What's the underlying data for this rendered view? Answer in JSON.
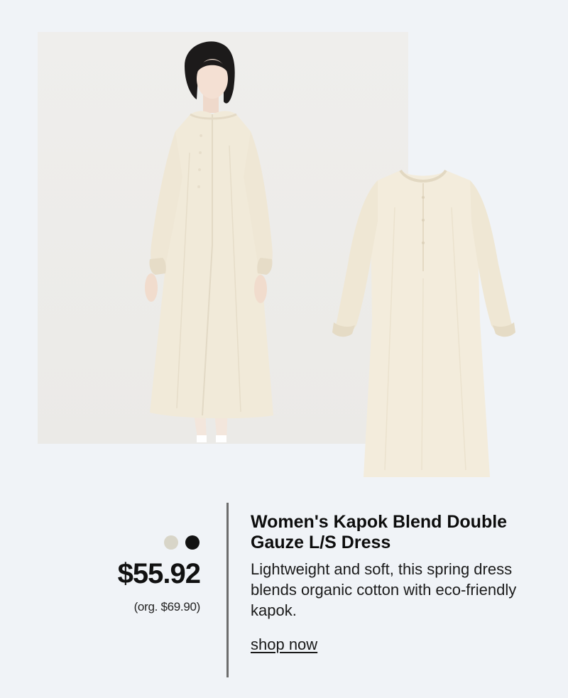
{
  "product": {
    "name": "Women's Kapok Blend Double Gauze L/S Dress",
    "description": "Lightweight and soft, this spring dress blends organic cotton with eco-friendly kapok.",
    "price": "$55.92",
    "original_price": "(org. $69.90)",
    "cta_label": "shop now",
    "colors": [
      {
        "name": "ecru",
        "hex": "#d8d5c8"
      },
      {
        "name": "black",
        "hex": "#121212"
      }
    ]
  },
  "images": {
    "model_photo": "model-wearing-dress-photo",
    "flat_photo": "dress-flat-lay-photo"
  },
  "theme": {
    "background": "#f0f3f7",
    "dress_color": "#f1ead9",
    "divider": "#6d6d6d"
  }
}
